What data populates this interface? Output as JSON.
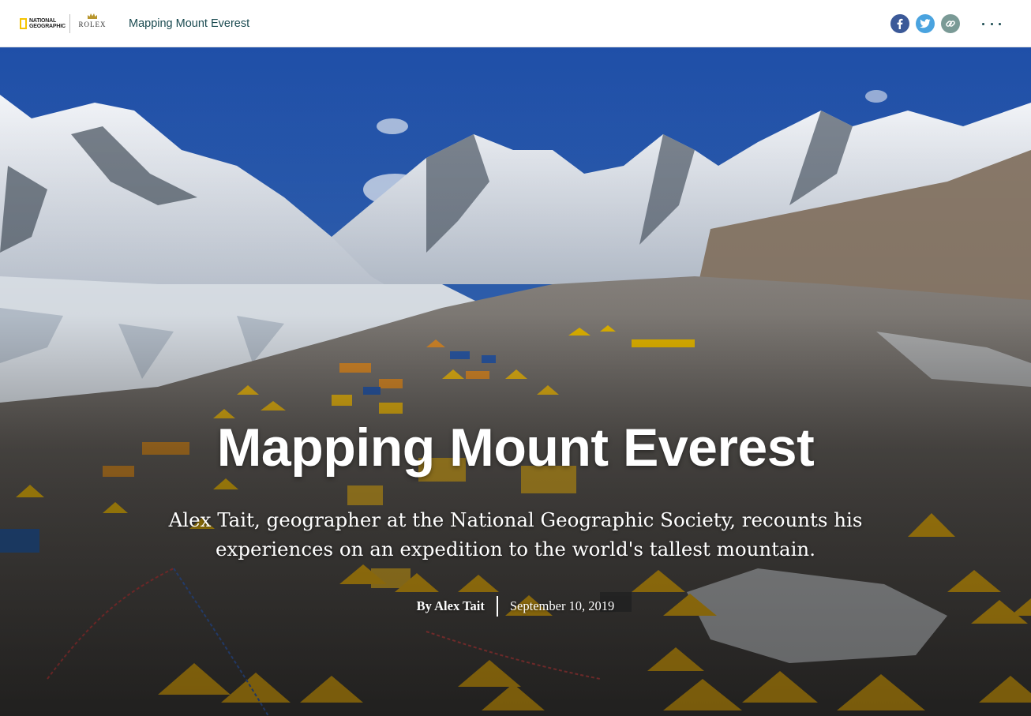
{
  "header": {
    "natgeo_logo_text": [
      "NATIONAL",
      "GEOGRAPHIC"
    ],
    "rolex_logo_text": "ROLEX",
    "site_title": "Mapping Mount Everest",
    "share_icons": [
      "facebook-icon",
      "twitter-icon",
      "link-icon"
    ],
    "more_icon": "more-options-icon"
  },
  "hero": {
    "title": "Mapping Mount Everest",
    "subtitle": "Alex Tait, geographer at the National Geographic Society, recounts his experiences on an expedition to the world's tallest mountain.",
    "author": "By Alex Tait",
    "date": "September 10, 2019"
  },
  "colors": {
    "brand_yellow": "#f5c400",
    "title_teal": "#1a4a50",
    "facebook": "#3b5998",
    "twitter": "#4aa3df",
    "link": "#7a9a96"
  }
}
